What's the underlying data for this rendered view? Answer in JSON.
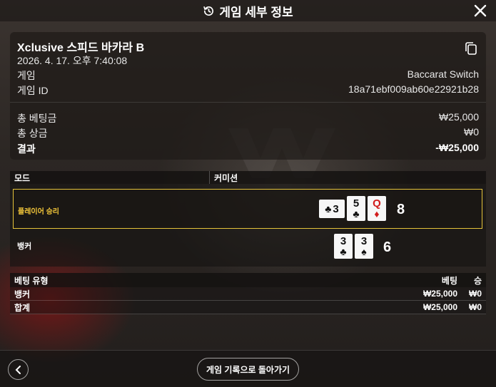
{
  "header": {
    "title": "게임 세부 정보",
    "history_icon": "history-icon",
    "close_icon": "close-icon"
  },
  "info": {
    "table_name": "Xclusive 스피드 바카라 B",
    "datetime": "2026. 4. 17. 오후 7:40:08",
    "game_label": "게임",
    "game_value": "Baccarat Switch",
    "game_id_label": "게임 ID",
    "game_id_value": "18a71ebf009ab60e22921b28",
    "total_bet_label": "총 베팅금",
    "total_bet_value": "₩25,000",
    "total_win_label": "총 상금",
    "total_win_value": "₩0",
    "result_label": "결과",
    "result_value": "-₩25,000",
    "copy_icon": "copy-icon"
  },
  "mode": {
    "mode_label": "모드",
    "mode_value": "커미션"
  },
  "player": {
    "label": "플레이어 승리",
    "score": "8",
    "cards": [
      {
        "rank": "3",
        "suit": "♣",
        "color": "#111111",
        "sideways": true
      },
      {
        "rank": "5",
        "suit": "♣",
        "color": "#111111",
        "sideways": false
      },
      {
        "rank": "Q",
        "suit": "♦",
        "color": "#d21d1d",
        "sideways": false
      }
    ]
  },
  "banker": {
    "label": "뱅커",
    "score": "6",
    "cards": [
      {
        "rank": "3",
        "suit": "♣",
        "color": "#111111",
        "sideways": false
      },
      {
        "rank": "3",
        "suit": "♠",
        "color": "#111111",
        "sideways": false
      }
    ]
  },
  "bets": {
    "type_header": "베팅 유형",
    "bet_header": "베팅",
    "win_header": "승",
    "rows": [
      {
        "type": "뱅커",
        "bet": "₩25,000",
        "win": "₩0"
      },
      {
        "type": "합계",
        "bet": "₩25,000",
        "win": "₩0"
      }
    ]
  },
  "footer": {
    "back_icon": "chevron-left-icon",
    "history_button": "게임 기록으로 돌아가기"
  },
  "colors": {
    "winner_accent": "#e5c33a",
    "red_suit": "#d21d1d"
  }
}
